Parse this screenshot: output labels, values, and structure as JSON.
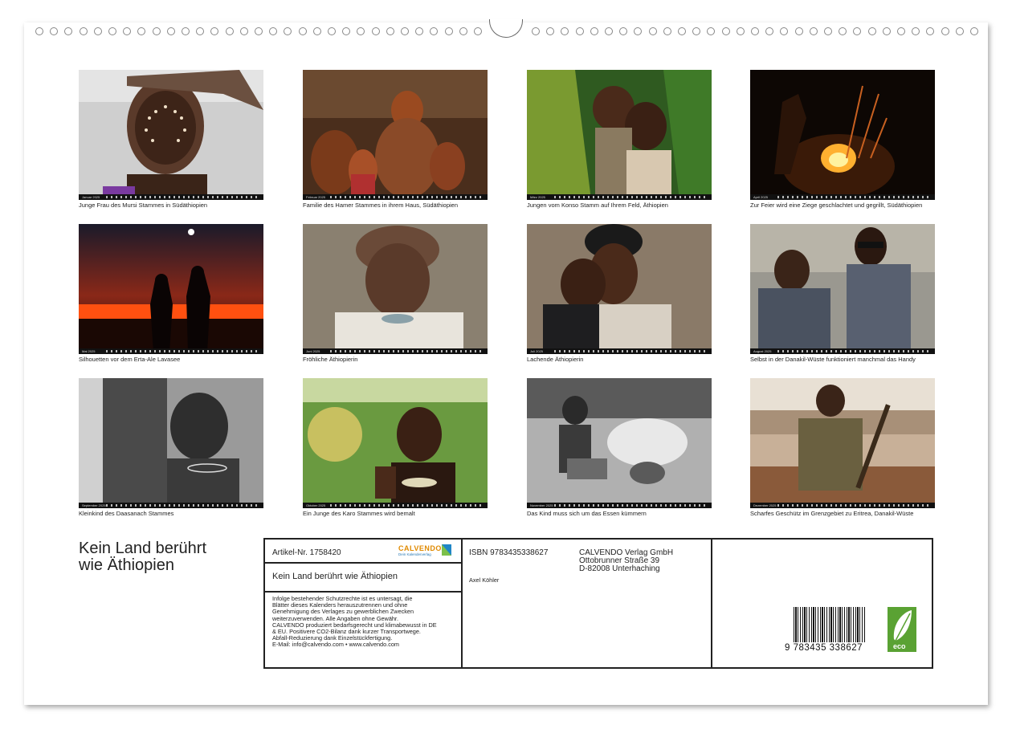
{
  "photos": [
    {
      "month": "Januar 2025",
      "caption": "Junge Frau des Mursi Stammes in Südäthiopien"
    },
    {
      "month": "Februar 2025",
      "caption": "Familie des Hamer Stammes in ihrem Haus, Südäthiopien"
    },
    {
      "month": "März 2025",
      "caption": "Jungen vom Konso Stamm auf Ihrem Feld, Äthiopien"
    },
    {
      "month": "April 2025",
      "caption": "Zur Feier wird eine Ziege geschlachtet und gegrillt, Südäthiopien"
    },
    {
      "month": "Mai 2025",
      "caption": "Silhouetten vor dem Erta-Ale Lavasee"
    },
    {
      "month": "Juni 2025",
      "caption": "Fröhliche Äthiopierin"
    },
    {
      "month": "Juli 2025",
      "caption": "Lachende Äthiopierin"
    },
    {
      "month": "August 2025",
      "caption": "Selbst in der Danakil-Wüste funktioniert manchmal das Handy"
    },
    {
      "month": "September 2025",
      "caption": "Kleinkind des Daasanach Stammes"
    },
    {
      "month": "Oktober 2025",
      "caption": "Ein Junge des Karo Stammes wird bemalt"
    },
    {
      "month": "November 2025",
      "caption": "Das Kind muss sich um das Essen kümmern"
    },
    {
      "month": "Dezember 2025",
      "caption": "Scharfes Geschütz im Grenzgebiet zu Eritrea, Danakil-Wüste"
    }
  ],
  "title": {
    "line1": "Kein Land berührt",
    "line2": "wie Äthiopien"
  },
  "info": {
    "article": "Artikel-Nr. 1758420",
    "calvendo_name": "CALVENDO",
    "calvendo_sub": "Dein Kalenderverlag",
    "book_title": "Kein Land berührt wie Äthiopien",
    "legal": [
      "Infolge bestehender Schutzrechte ist es untersagt, die",
      "Blätter dieses Kalenders herauszutrennen und ohne",
      "Genehmigung des Verlages zu gewerblichen Zwecken",
      "weiterzuverwenden. Alle Angaben ohne Gewähr.",
      "CALVENDO produziert bedarfsgerecht und klimabewusst in DE",
      "& EU. Positivere CO2-Bilanz dank kurzer Transportwege.",
      "Abfall-Reduzierung dank Einzelstückfertigung.",
      "E-Mail: info@calvendo.com • www.calvendo.com"
    ],
    "isbn": "ISBN 9783435338627",
    "author": "Axel Köhler",
    "publisher": [
      "CALVENDO Verlag GmbH",
      "Ottobrunner Straße 39",
      "D-82008 Unterhaching"
    ],
    "barcode_number": "9 783435 338627",
    "eco_label": "eco"
  }
}
